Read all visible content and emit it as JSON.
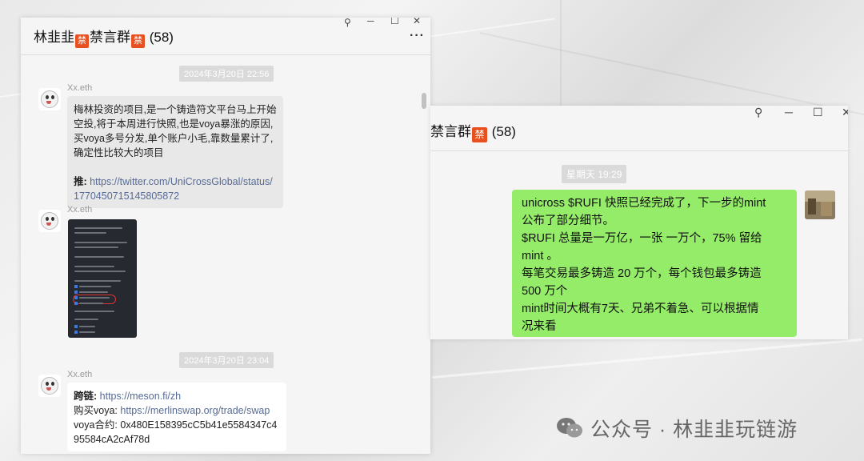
{
  "left_window": {
    "title": "林韭韭",
    "title_mid": "禁言群",
    "ban_badge": "禁",
    "member_count": "(58)",
    "messages": [
      {
        "timestamp": "2024年3月20日 22:56",
        "sender": "Xx.eth",
        "text": "梅林投资的项目,是一个铸造符文平台马上开始空投,将于本周进行快照,也是voya暴涨的原因,买voya多号分发,单个账户小毛,靠数量累计了,确定性比较大的项目",
        "link_prefix": "推:",
        "link": "https://twitter.com/UniCrossGlobal/status/1770450715145805872"
      },
      {
        "sender": "Xx.eth",
        "image": "screenshot"
      },
      {
        "timestamp": "2024年3月20日 23:04",
        "sender": "Xx.eth",
        "lines": [
          {
            "label": "跨链:",
            "value": "https://meson.fi/zh",
            "is_link": true
          },
          {
            "label": "购买voya:",
            "value": "https://merlinswap.org/trade/swap",
            "is_link": true
          },
          {
            "label": "voya合约:",
            "value": "0x480E158395cC5b41e5584347c495584cA2cAf78d",
            "is_link": false
          }
        ]
      }
    ]
  },
  "right_window": {
    "title": "禁言群",
    "ban_badge": "禁",
    "member_count": "(58)",
    "timestamp": "星期天 19:29",
    "message_lines": [
      "unicross $RUFI 快照已经完成了，下一步的mint",
      "公布了部分细节。",
      "$RUFI 总量是一万亿，一张 一万个，75% 留给",
      "mint 。",
      "每笔交易最多铸造 20 万个，每个钱包最多铸造",
      "500 万个",
      "mint时间大概有7天、兄弟不着急、可以根据情",
      "况来看"
    ]
  },
  "window_controls": {
    "pin": "⚲",
    "minimize": "─",
    "maximize": "☐",
    "close": "✕",
    "more": "···"
  },
  "watermark": {
    "text": "公众号 · 林韭韭玩链游",
    "icon": "wechat-icon"
  }
}
